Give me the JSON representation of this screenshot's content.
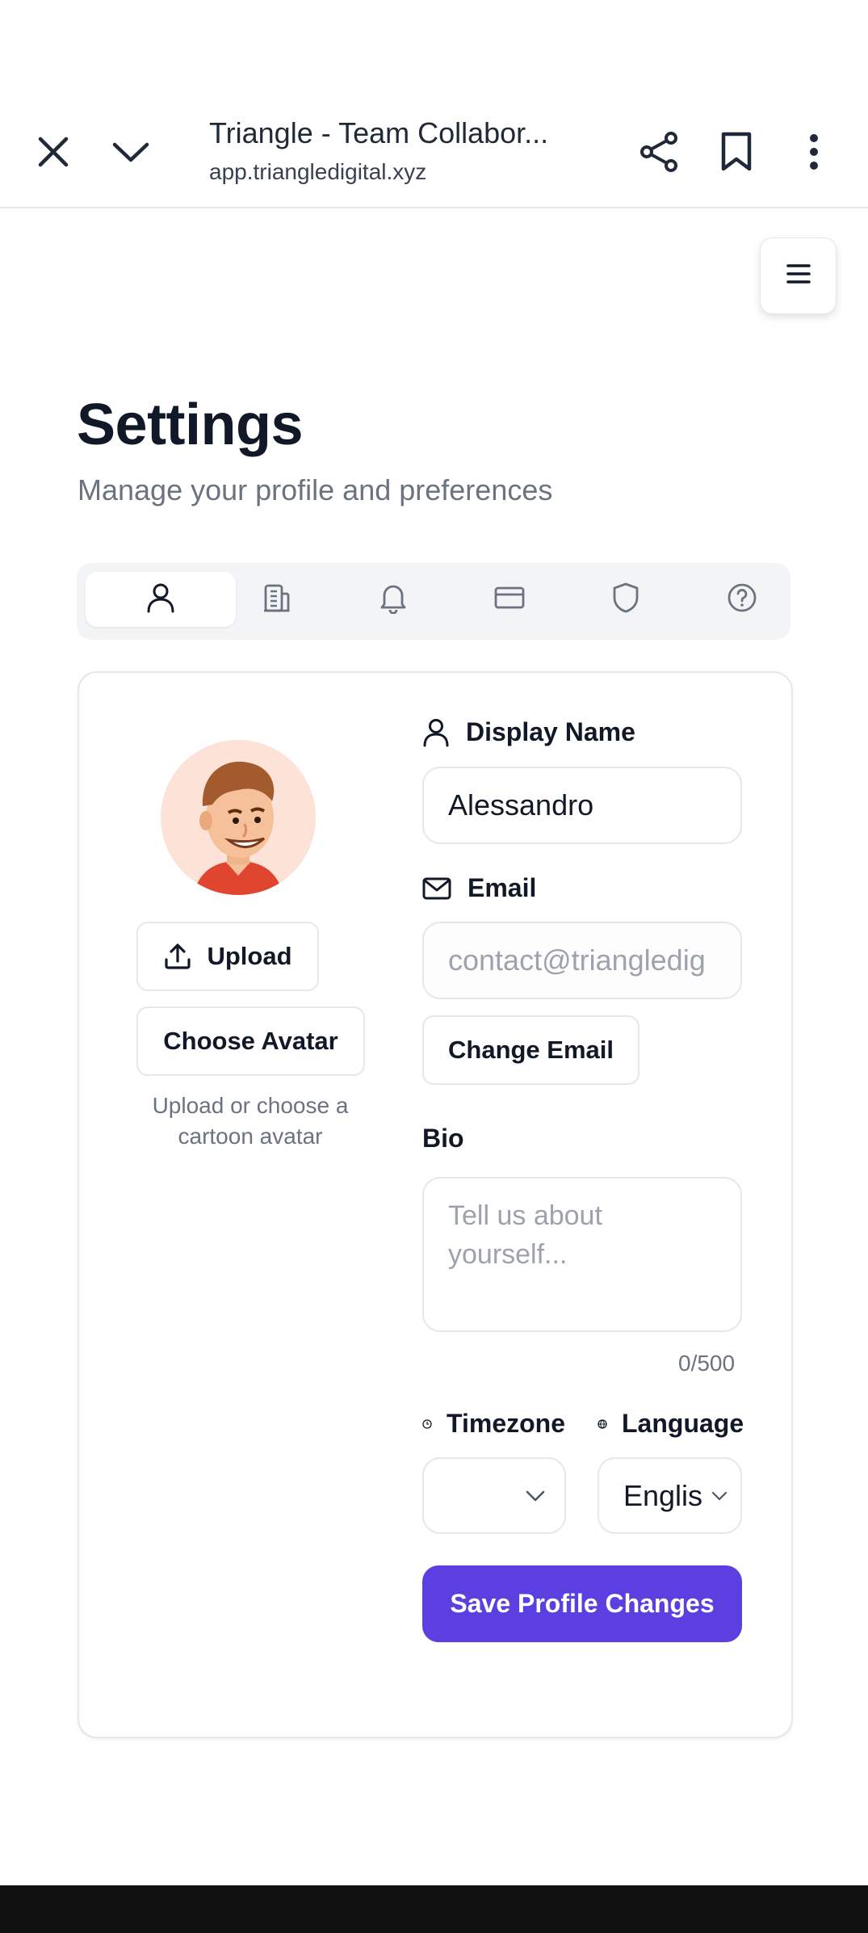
{
  "browser": {
    "title": "Triangle - Team Collabor...",
    "url": "app.triangledigital.xyz"
  },
  "page": {
    "title": "Settings",
    "subtitle": "Manage your profile and preferences"
  },
  "tabs": [
    {
      "icon": "user-icon",
      "active": true
    },
    {
      "icon": "building-icon",
      "active": false
    },
    {
      "icon": "bell-icon",
      "active": false
    },
    {
      "icon": "credit-card-icon",
      "active": false
    },
    {
      "icon": "shield-icon",
      "active": false
    },
    {
      "icon": "help-circle-icon",
      "active": false
    }
  ],
  "profile": {
    "upload_label": "Upload",
    "choose_avatar_label": "Choose Avatar",
    "avatar_hint": "Upload or choose a cartoon avatar",
    "display_name_label": "Display Name",
    "display_name_value": "Alessandro",
    "email_label": "Email",
    "email_value": "contact@triangledig",
    "change_email_label": "Change Email",
    "bio_label": "Bio",
    "bio_placeholder": "Tell us about yourself...",
    "bio_count": "0/500",
    "timezone_label": "Timezone",
    "timezone_value": "",
    "language_label": "Language",
    "language_value": "Englis",
    "save_label": "Save Profile Changes"
  },
  "colors": {
    "accent": "#5b3fe0",
    "border": "#e5e7eb",
    "muted_text": "#6b7280"
  }
}
